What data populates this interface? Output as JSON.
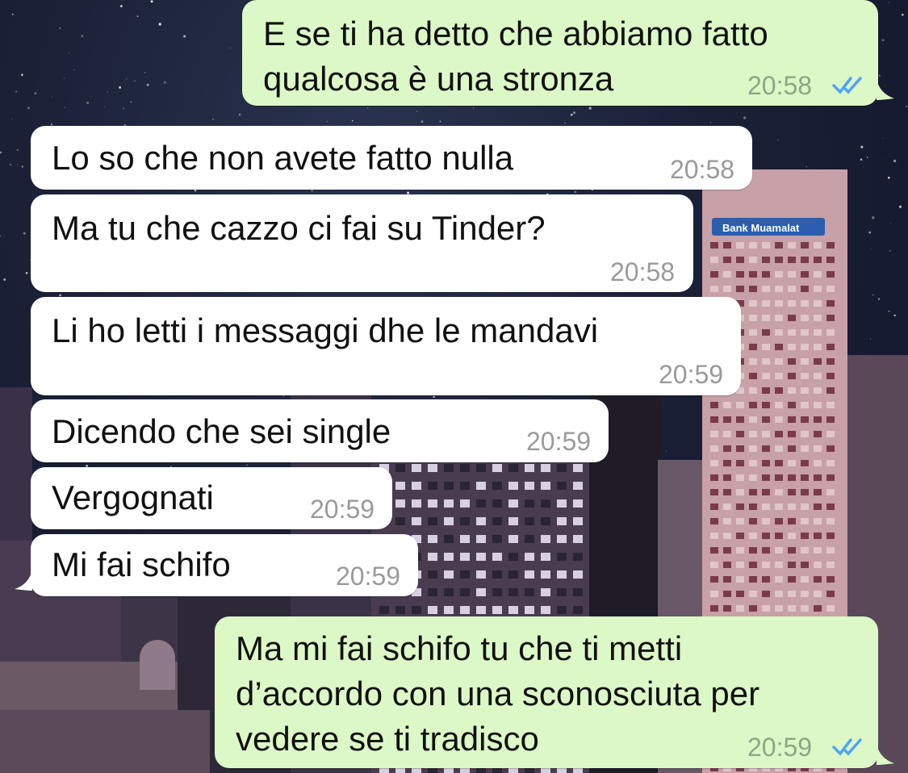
{
  "colors": {
    "incoming_bubble": "#ffffff",
    "outgoing_bubble": "#dcf8c6",
    "read_ticks": "#4fa3f7",
    "timestamp": "#9a9a9a"
  },
  "wallpaper": {
    "billboard": "Bank Muamalat"
  },
  "messages": [
    {
      "direction": "outgoing",
      "text": "E se ti ha detto che abbiamo fatto\nqualcosa è una stronza",
      "time": "20:58",
      "status": "read"
    },
    {
      "direction": "incoming",
      "text": "Lo so che non avete fatto nulla",
      "time": "20:58"
    },
    {
      "direction": "incoming",
      "text": "Ma tu che cazzo ci fai su Tinder?",
      "time": "20:58"
    },
    {
      "direction": "incoming",
      "text": "Li ho letti i messaggi dhe le mandavi",
      "time": "20:59"
    },
    {
      "direction": "incoming",
      "text": "Dicendo che sei single",
      "time": "20:59"
    },
    {
      "direction": "incoming",
      "text": "Vergognati",
      "time": "20:59"
    },
    {
      "direction": "incoming",
      "text": "Mi fai schifo",
      "time": "20:59"
    },
    {
      "direction": "outgoing",
      "text": "Ma mi fai schifo tu che ti metti\nd’accordo con una sconosciuta per\nvedere se ti tradisco",
      "time": "20:59",
      "status": "read"
    }
  ]
}
